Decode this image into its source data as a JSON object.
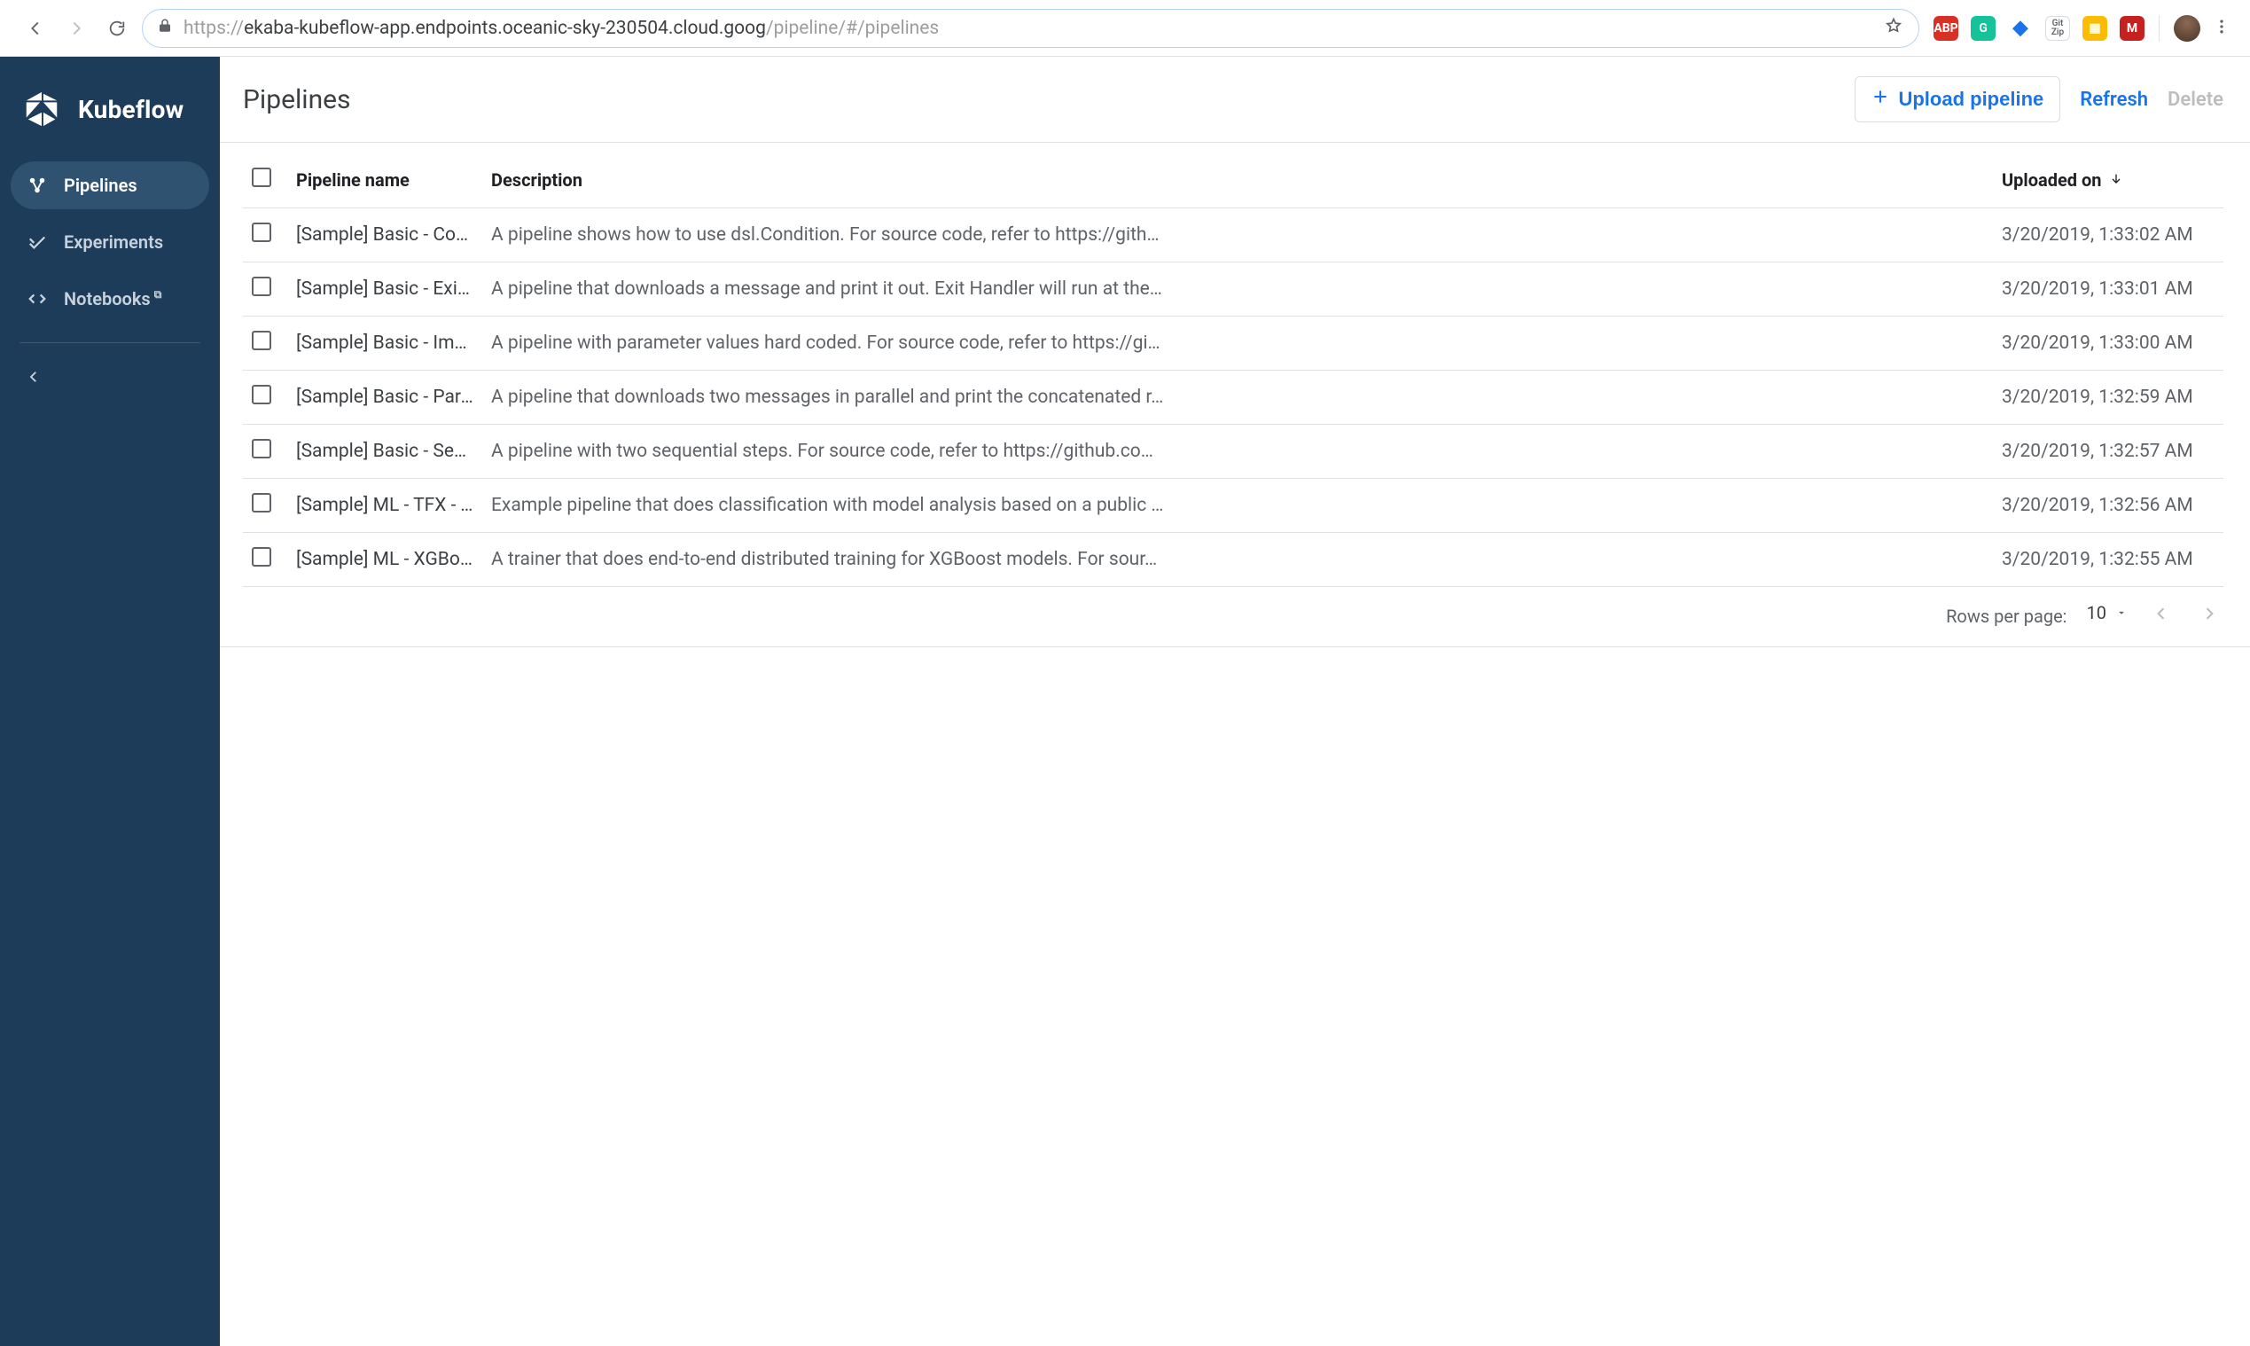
{
  "browser": {
    "url_scheme": "https://",
    "url_host": "ekaba-kubeflow-app.endpoints.oceanic-sky-230504.cloud.goog",
    "url_path": "/pipeline/#/pipelines",
    "extensions": [
      {
        "id": "abp",
        "label": "ABP",
        "bg": "#d93025",
        "fg": "#ffffff"
      },
      {
        "id": "grammarly",
        "label": "G",
        "bg": "#15c39a",
        "fg": "#ffffff"
      },
      {
        "id": "diamond",
        "label": "◆",
        "bg": "#ffffff",
        "fg": "#1a73e8"
      },
      {
        "id": "gitzip",
        "label": "Git\nZip",
        "bg": "#ffffff",
        "fg": "#5f6368"
      },
      {
        "id": "slides",
        "label": "▦",
        "bg": "#fbbc04",
        "fg": "#ffffff"
      },
      {
        "id": "mendeley",
        "label": "M",
        "bg": "#c5221f",
        "fg": "#ffffff"
      }
    ]
  },
  "sidebar": {
    "brand": "Kubeflow",
    "items": [
      {
        "key": "pipelines",
        "label": "Pipelines",
        "active": true
      },
      {
        "key": "experiments",
        "label": "Experiments",
        "active": false
      },
      {
        "key": "notebooks",
        "label": "Notebooks",
        "active": false,
        "external": true
      }
    ]
  },
  "page": {
    "title": "Pipelines",
    "upload_label": "Upload pipeline",
    "refresh_label": "Refresh",
    "delete_label": "Delete"
  },
  "table": {
    "columns": {
      "name": "Pipeline name",
      "description": "Description",
      "uploaded": "Uploaded on"
    },
    "sort_column": "uploaded",
    "sort_direction": "desc",
    "rows": [
      {
        "name": "[Sample] Basic - Condition",
        "description": "A pipeline shows how to use dsl.Condition. For source code, refer to https://gith…",
        "uploaded": "3/20/2019, 1:33:02 AM"
      },
      {
        "name": "[Sample] Basic - Exit Ha…",
        "description": "A pipeline that downloads a message and print it out. Exit Handler will run at the…",
        "uploaded": "3/20/2019, 1:33:01 AM"
      },
      {
        "name": "[Sample] Basic - Immedi…",
        "description": "A pipeline with parameter values hard coded. For source code, refer to https://gi…",
        "uploaded": "3/20/2019, 1:33:00 AM"
      },
      {
        "name": "[Sample] Basic - Parallel …",
        "description": "A pipeline that downloads two messages in parallel and print the concatenated r…",
        "uploaded": "3/20/2019, 1:32:59 AM"
      },
      {
        "name": "[Sample] Basic - Sequen…",
        "description": "A pipeline with two sequential steps. For source code, refer to https://github.co…",
        "uploaded": "3/20/2019, 1:32:57 AM"
      },
      {
        "name": "[Sample] ML - TFX - Taxi …",
        "description": "Example pipeline that does classification with model analysis based on a public …",
        "uploaded": "3/20/2019, 1:32:56 AM"
      },
      {
        "name": "[Sample] ML - XGBoost -…",
        "description": "A trainer that does end-to-end distributed training for XGBoost models. For sour…",
        "uploaded": "3/20/2019, 1:32:55 AM"
      }
    ]
  },
  "pager": {
    "label": "Rows per page:",
    "size": "10"
  }
}
